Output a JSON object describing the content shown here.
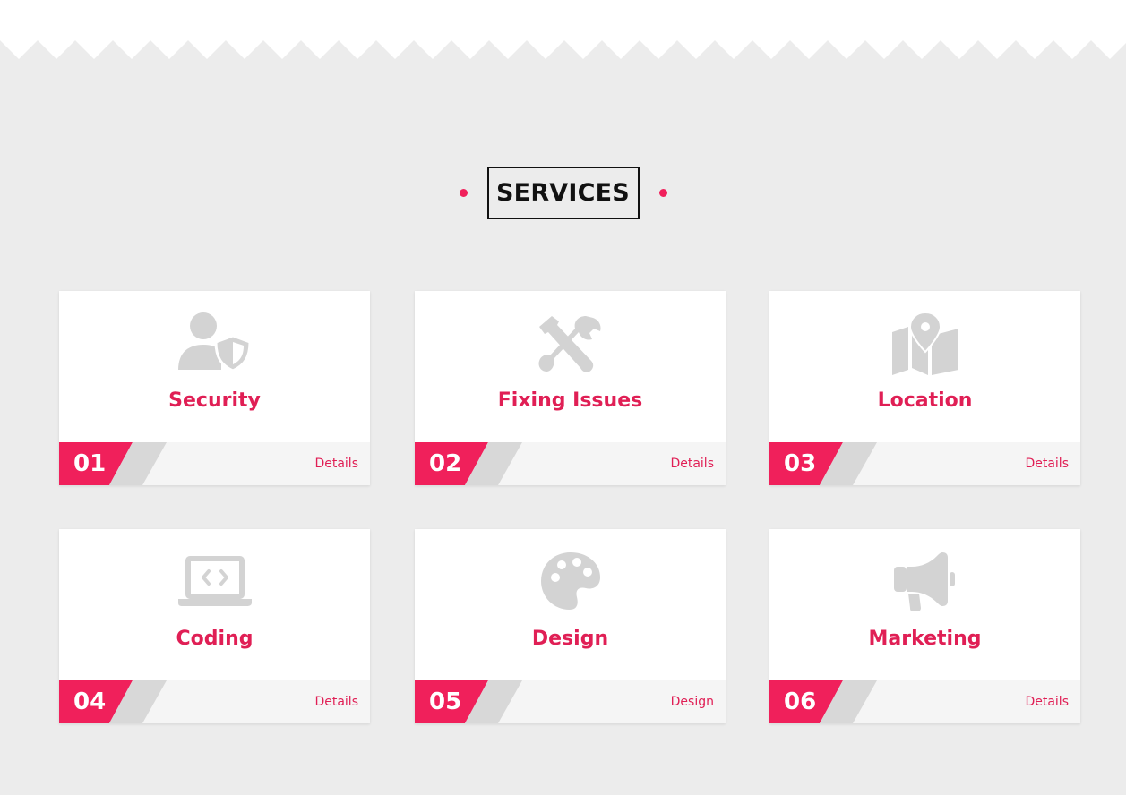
{
  "section": {
    "title": "SERVICES"
  },
  "colors": {
    "accent": "#f0205b",
    "title_pink": "#e01f55",
    "icon_gray": "#d3d3d3",
    "background": "#ececec",
    "footer": "#f5f5f5"
  },
  "services": [
    {
      "number": "01",
      "title": "Security",
      "link": "Details",
      "icon": "user-shield-icon"
    },
    {
      "number": "02",
      "title": "Fixing Issues",
      "link": "Details",
      "icon": "tools-icon"
    },
    {
      "number": "03",
      "title": "Location",
      "link": "Details",
      "icon": "map-location-icon"
    },
    {
      "number": "04",
      "title": "Coding",
      "link": "Details",
      "icon": "laptop-code-icon"
    },
    {
      "number": "05",
      "title": "Design",
      "link": "Design",
      "icon": "palette-icon"
    },
    {
      "number": "06",
      "title": "Marketing",
      "link": "Details",
      "icon": "bullhorn-icon"
    }
  ]
}
